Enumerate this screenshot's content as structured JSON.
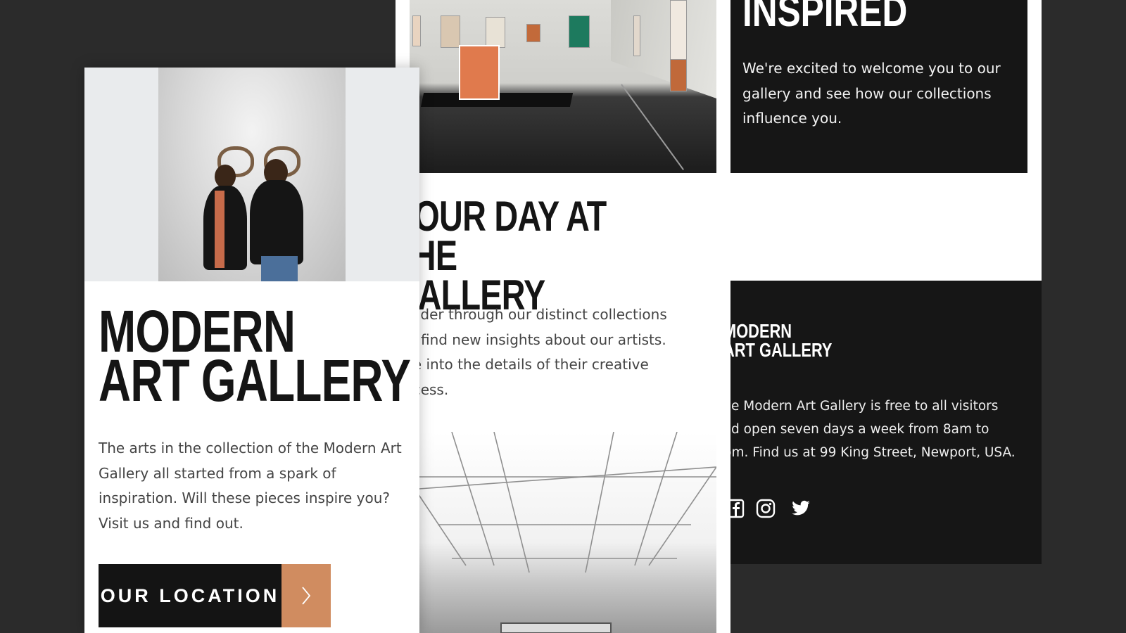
{
  "left_card": {
    "title_line1": "MODERN",
    "title_line2": "ART GALLERY",
    "text": "The arts in the collection of the Modern Art Gallery all started from a spark of inspiration. Will these pieces inspire you? Visit us and find out.",
    "cta_label": "OUR LOCATION",
    "cta_icon": "chevron-right-icon"
  },
  "middle_card": {
    "title_line1": "YOUR DAY AT THE",
    "title_line2": "GALLERY",
    "text": "Wander through our distinct collections and find new insights about our artists. Dive into the details of their creative process."
  },
  "right_card": {
    "heading": "INSPIRED",
    "text": "We're excited to welcome you to our gallery and see how our collections influence you.",
    "footer": {
      "logo_line1": "MODERN",
      "logo_line2": "ART GALLERY",
      "text": "The Modern Art Gallery is free to all visitors and open seven days a week from 8am to 9pm. Find us at 99 King Street, Newport, USA.",
      "social": [
        "facebook-icon",
        "instagram-icon",
        "twitter-icon"
      ]
    }
  },
  "colors": {
    "background": "#2b2b2b",
    "dark": "#161616",
    "accent": "#d08c60",
    "text_gray": "#444444"
  }
}
